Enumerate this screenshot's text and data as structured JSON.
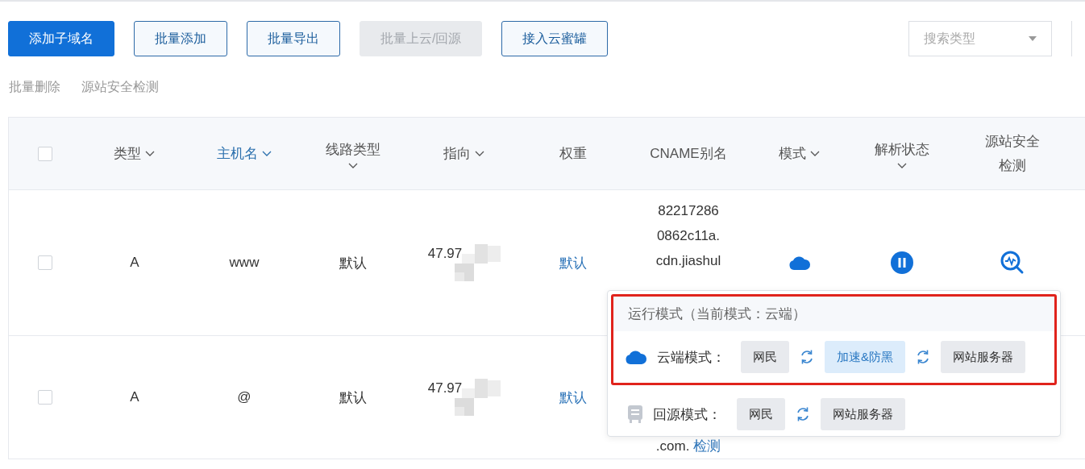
{
  "toolbar": {
    "buttons": [
      {
        "label": "添加子域名",
        "kind": "primary",
        "disabled": false
      },
      {
        "label": "批量添加",
        "kind": "outline",
        "disabled": false
      },
      {
        "label": "批量导出",
        "kind": "outline",
        "disabled": false
      },
      {
        "label": "批量上云/回源",
        "kind": "outline",
        "disabled": true
      },
      {
        "label": "接入云蜜罐",
        "kind": "outline",
        "disabled": false
      }
    ],
    "search_select": {
      "placeholder": "搜索类型"
    }
  },
  "links": [
    "批量删除",
    "源站安全检测"
  ],
  "table": {
    "header_checkbox": {
      "checked": false
    },
    "columns": [
      {
        "label": "类型",
        "sortable": true,
        "selected": false
      },
      {
        "label": "主机名",
        "sortable": true,
        "selected": true
      },
      {
        "label": "线路类型",
        "sortable": true,
        "selected": false
      },
      {
        "label": "指向",
        "sortable": true,
        "selected": false
      },
      {
        "label": "权重",
        "sortable": false,
        "selected": false
      },
      {
        "label": "CNAME别名",
        "sortable": false,
        "selected": false
      },
      {
        "label": "模式",
        "sortable": true,
        "selected": false
      },
      {
        "label": "解析状态",
        "sortable": true,
        "selected": false
      },
      {
        "label": "源站安全检测",
        "sortable": false,
        "selected": false
      }
    ],
    "rows": [
      {
        "checked": false,
        "type": "A",
        "host": "www",
        "line": "默认",
        "target": "47.97",
        "weight": "默认",
        "cname": [
          "82217286",
          "0862c11a.",
          "cdn.jiashul"
        ],
        "mode": {
          "kind": "cloud"
        },
        "status": {
          "kind": "paused"
        },
        "security": {
          "kind": "scan"
        }
      },
      {
        "checked": false,
        "type": "A",
        "host": "@",
        "line": "默认",
        "target": "47.97",
        "weight": "默认",
        "cname_tail": {
          "text": ".com.",
          "link": "检测"
        }
      }
    ]
  },
  "mode_popup": {
    "title": "运行模式（当前模式：云端）",
    "highlight_frame": true,
    "modes": [
      {
        "kind": "cloud",
        "label": "云端模式：",
        "chain": [
          {
            "label": "网民",
            "active": false
          },
          {
            "label": "加速&防黑",
            "active": true
          },
          {
            "label": "网站服务器",
            "active": false
          }
        ]
      },
      {
        "kind": "server",
        "label": "回源模式：",
        "chain": [
          {
            "label": "网民",
            "active": false
          },
          {
            "label": "网站服务器",
            "active": false
          }
        ]
      }
    ]
  }
}
